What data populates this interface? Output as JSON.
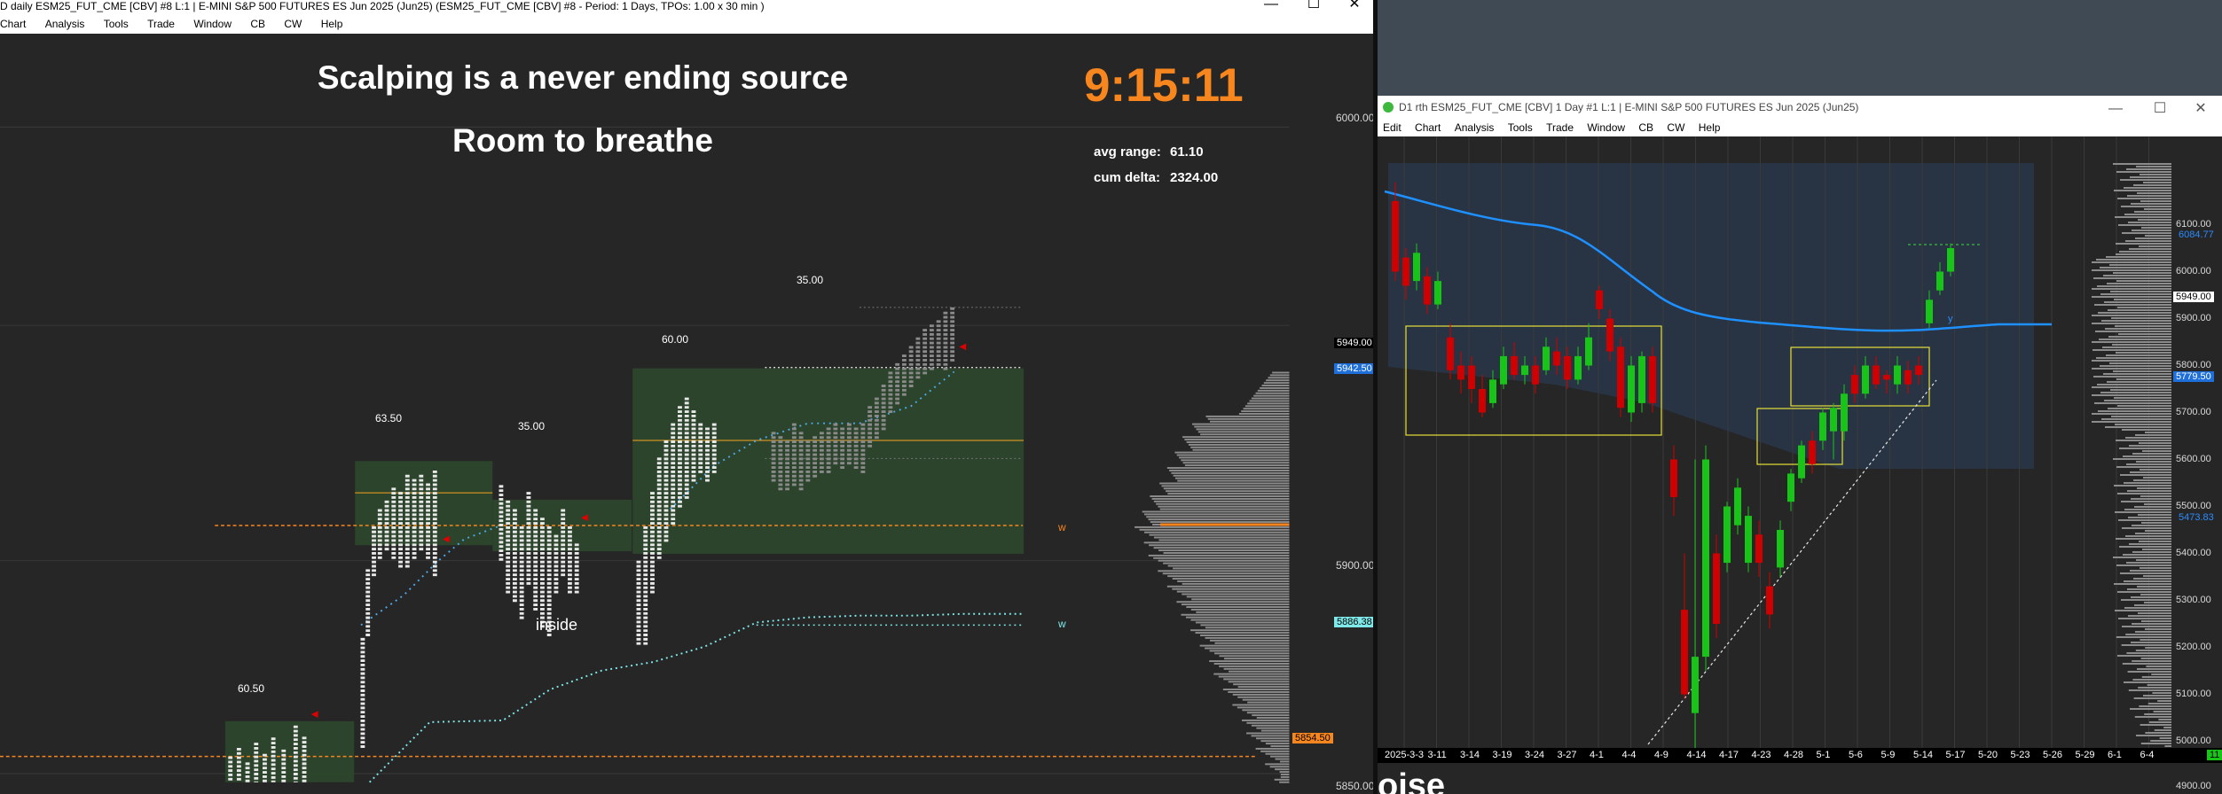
{
  "left_window": {
    "title": "D daily ESM25_FUT_CME [CBV] #8 L:1 | E-MINI S&P 500 FUTURES ES Jun 2025 (Jun25) (ESM25_FUT_CME [CBV] #8 - Period: 1 Days, TPOs: 1.00 x 30 min  )",
    "menu": [
      "Chart",
      "Analysis",
      "Tools",
      "Trade",
      "Window",
      "CB",
      "CW",
      "Help"
    ],
    "window_controls": [
      "—",
      "☐",
      "✕"
    ],
    "headline_1": "Scalping is a never ending source",
    "headline_2": "Room to breathe",
    "clock": "9:15:11",
    "stats": {
      "avg_range_label": "avg range:",
      "avg_range_value": "61.10",
      "cum_delta_label": "cum delta:",
      "cum_delta_value": "2324.00"
    },
    "profile_ranges": [
      "60.50",
      "63.50",
      "35.00",
      "60.00",
      "35.00"
    ],
    "annotation_inside": "inside",
    "level_markers": [
      "w",
      "w"
    ],
    "price_axis": [
      "6000.00",
      "5950.00",
      "5900.00",
      "5850.00"
    ],
    "price_tags": [
      {
        "text": "5949.00",
        "color": "#ffffff",
        "bg": "#000000"
      },
      {
        "text": "5942.50",
        "color": "#ffffff",
        "bg": "#1e6fd9"
      },
      {
        "text": "5886.38",
        "color": "#000000",
        "bg": "#7fe8e8"
      },
      {
        "text": "5854.50",
        "color": "#000000",
        "bg": "#f7861f"
      }
    ]
  },
  "right_window": {
    "title": "D1 rth ESM25_FUT_CME [CBV]  1 Day  #1 L:1 | E-MINI S&P 500 FUTURES ES Jun 2025 (Jun25)",
    "menu": [
      "Edit",
      "Chart",
      "Analysis",
      "Tools",
      "Trade",
      "Window",
      "CB",
      "CW",
      "Help"
    ],
    "window_controls": [
      "—",
      "☐",
      "✕"
    ],
    "price_axis": [
      "6100.00",
      "6000.00",
      "5900.00",
      "5800.00",
      "5700.00",
      "5600.00",
      "5500.00",
      "5400.00",
      "5300.00",
      "5200.00",
      "5100.00",
      "5000.00",
      "4900.00"
    ],
    "price_tags": [
      {
        "text": "6084.77",
        "color": "#2a8cff",
        "bg": "transparent"
      },
      {
        "text": "5949.00",
        "color": "#000000",
        "bg": "#ffffff"
      },
      {
        "text": "5779.50",
        "color": "#ffffff",
        "bg": "#1e6fd9"
      },
      {
        "text": "5473.83",
        "color": "#2a8cff",
        "bg": "transparent"
      }
    ],
    "date_axis": [
      "2025-3-3",
      "3-11",
      "3-14",
      "3-19",
      "3-24",
      "3-27",
      "4-1",
      "4-4",
      "4-9",
      "4-14",
      "4-17",
      "4-23",
      "4-28",
      "5-1",
      "5-6",
      "5-9",
      "5-14",
      "5-17",
      "5-20",
      "5-23",
      "5-26",
      "5-29",
      "6-1",
      "6-4"
    ],
    "ma_label": "y",
    "corner_badge": "11",
    "cut_text": "oise"
  },
  "colors": {
    "accent_orange": "#f7861f",
    "up_candle": "#19c419",
    "down_candle": "#d00000",
    "ma_line": "#1e90ff",
    "box": "#e6e03a",
    "value_area": "#2d4a2d"
  }
}
